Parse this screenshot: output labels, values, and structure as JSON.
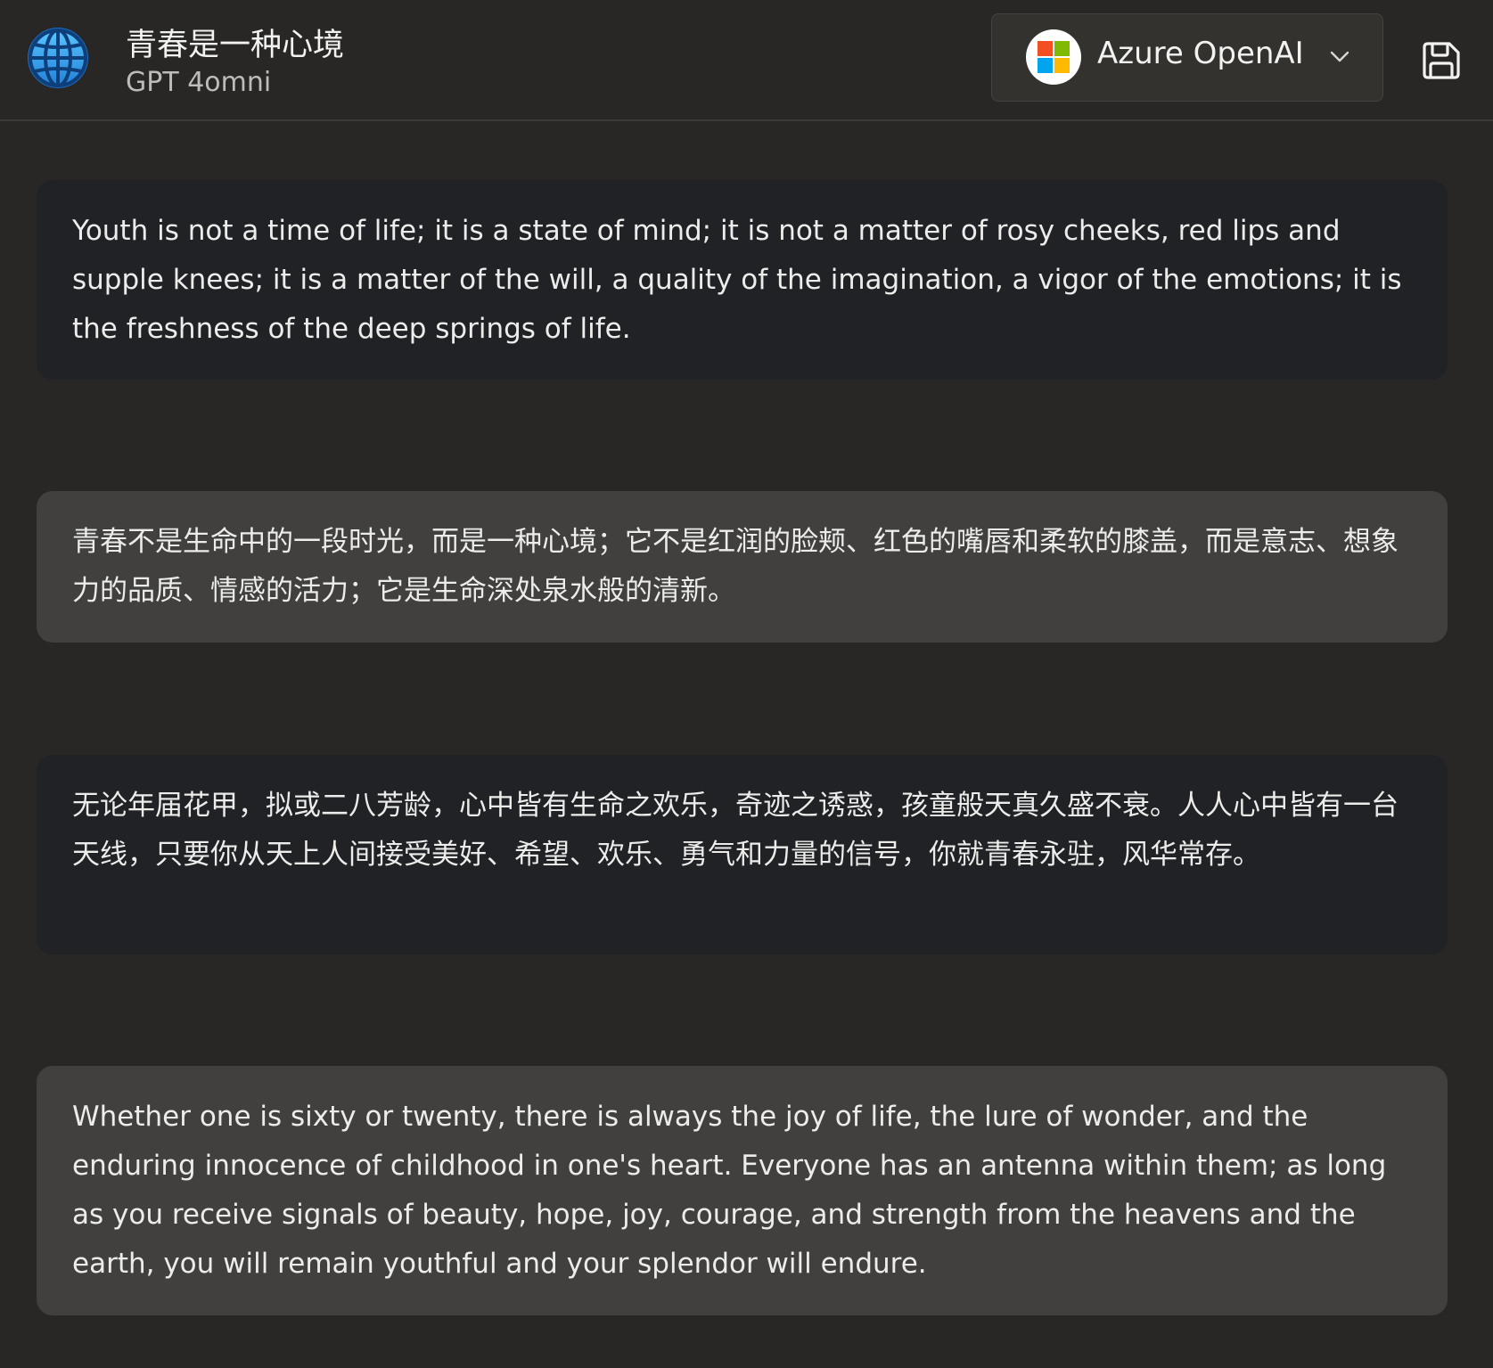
{
  "header": {
    "title": "青春是一种心境",
    "subtitle": "GPT 4omni",
    "app_icon": "globe-icon",
    "provider": {
      "label": "Azure OpenAI",
      "icon": "microsoft-logo",
      "dropdown_icon": "chevron-down-icon"
    },
    "save_icon": "save-icon"
  },
  "messages": [
    {
      "role": "assistant",
      "text": "Youth is not a time of life; it is a state of mind; it is not a matter of rosy cheeks, red lips and supple knees; it is a matter of the will, a quality of the imagination, a vigor of the emotions; it is the freshness of the deep springs of life."
    },
    {
      "role": "user",
      "text": "青春不是生命中的一段时光，而是一种心境；它不是红润的脸颊、红色的嘴唇和柔软的膝盖，而是意志、想象力的品质、情感的活力；它是生命深处泉水般的清新。"
    },
    {
      "role": "assistant",
      "text": "无论年届花甲，拟或二八芳龄，心中皆有生命之欢乐，奇迹之诱惑，孩童般天真久盛不衰。人人心中皆有一台天线，只要你从天上人间接受美好、希望、欢乐、勇气和力量的信号，你就青春永驻，风华常存。"
    },
    {
      "role": "user",
      "text": "Whether one is sixty or twenty, there is always the joy of life, the lure of wonder, and the enduring innocence of childhood in one's heart. Everyone has an antenna within them; as long as you receive signals of beauty, hope, joy, courage, and strength from the heavens and the earth, you will remain youthful and your splendor will endure."
    }
  ],
  "colors": {
    "background": "#282725",
    "assistant_bubble": "#202226",
    "user_bubble": "#41403e",
    "text": "#ececea",
    "globe_accent": "#3ea6f2"
  }
}
